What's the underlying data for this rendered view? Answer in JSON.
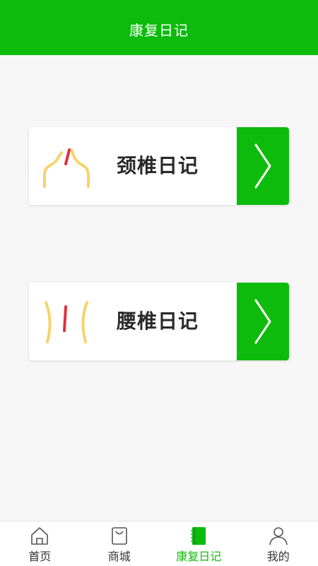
{
  "header": {
    "title": "康复日记"
  },
  "cards": [
    {
      "label": "颈椎日记",
      "icon": "neck-spine-icon",
      "action_icon": "chevron-right-icon"
    },
    {
      "label": "腰椎日记",
      "icon": "lumbar-spine-icon",
      "action_icon": "chevron-right-icon"
    }
  ],
  "tabbar": {
    "items": [
      {
        "label": "首页",
        "icon": "home-icon",
        "active": false
      },
      {
        "label": "商城",
        "icon": "shopping-bag-icon",
        "active": false
      },
      {
        "label": "康复日记",
        "icon": "notebook-icon",
        "active": true
      },
      {
        "label": "我的",
        "icon": "user-icon",
        "active": false
      }
    ]
  },
  "colors": {
    "primary_green": "#0cbb0c",
    "background": "#f6f6f6",
    "card_text": "#2a2a2a",
    "icon_yellow": "#f6d36b",
    "icon_red": "#e0323a"
  }
}
